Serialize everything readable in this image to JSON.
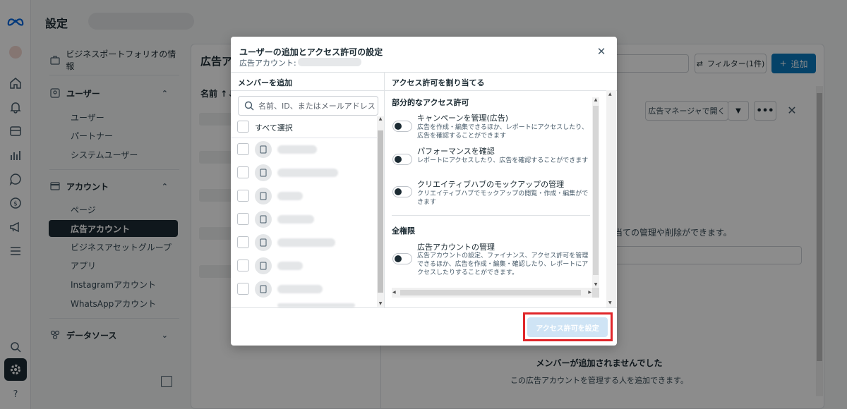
{
  "header": {
    "title": "設定"
  },
  "sidebar": {
    "business_info": "ビジネスポートフォリオの情報",
    "users_section": "ユーザー",
    "users_items": [
      "ユーザー",
      "パートナー",
      "システムユーザー"
    ],
    "accounts_section": "アカウント",
    "accounts_items": [
      "ページ",
      "広告アカウント",
      "ビジネスアセットグループ",
      "アプリ",
      "Instagramアカウント",
      "WhatsAppアカウント"
    ],
    "data_sources": "データソース"
  },
  "main": {
    "title": "広告ア",
    "sort_label": "名前 ↑↓",
    "filter_label": "フィルター(1件)",
    "add_label": "追加",
    "open_ads_manager": "広告マネージャで開く",
    "more": "•••",
    "desc": "当ての管理や削除ができます。",
    "empty_title": "メンバーが追加されませんでした",
    "empty_sub": "この広告アカウントを管理する人を追加できます。"
  },
  "modal": {
    "title": "ユーザーの追加とアクセス許可の設定",
    "subtitle": "広告アカウント:",
    "left_header": "メンバーを追加",
    "right_header": "アクセス許可を割り当てる",
    "search_placeholder": "名前、ID、またはメールアドレス",
    "select_all": "すべて選択",
    "partial_access": "部分的なアクセス許可",
    "full_access": "全権限",
    "permissions_partial": [
      {
        "title": "キャンペーンを管理(広告)",
        "desc": "広告を作成・編集できるほか、レポートにアクセスしたり、広告を確認することができます"
      },
      {
        "title": "パフォーマンスを確認",
        "desc": "レポートにアクセスしたり、広告を確認することができます"
      },
      {
        "title": "クリエイティブハブのモックアップの管理",
        "desc": "クリエイティブハブでモックアップの閲覧・作成・編集ができます"
      }
    ],
    "permissions_full": [
      {
        "title": "広告アカウントの管理",
        "desc": "広告アカウントの設定、ファイナンス、アクセス許可を管理できるほか、広告を作成・編集・確認したり、レポートにアクセスしたりすることができます。"
      }
    ],
    "set_button": "アクセス許可を設定"
  },
  "colors": {
    "accent": "#0a78be",
    "highlight": "#e0262a",
    "dark": "#1c2b33"
  }
}
